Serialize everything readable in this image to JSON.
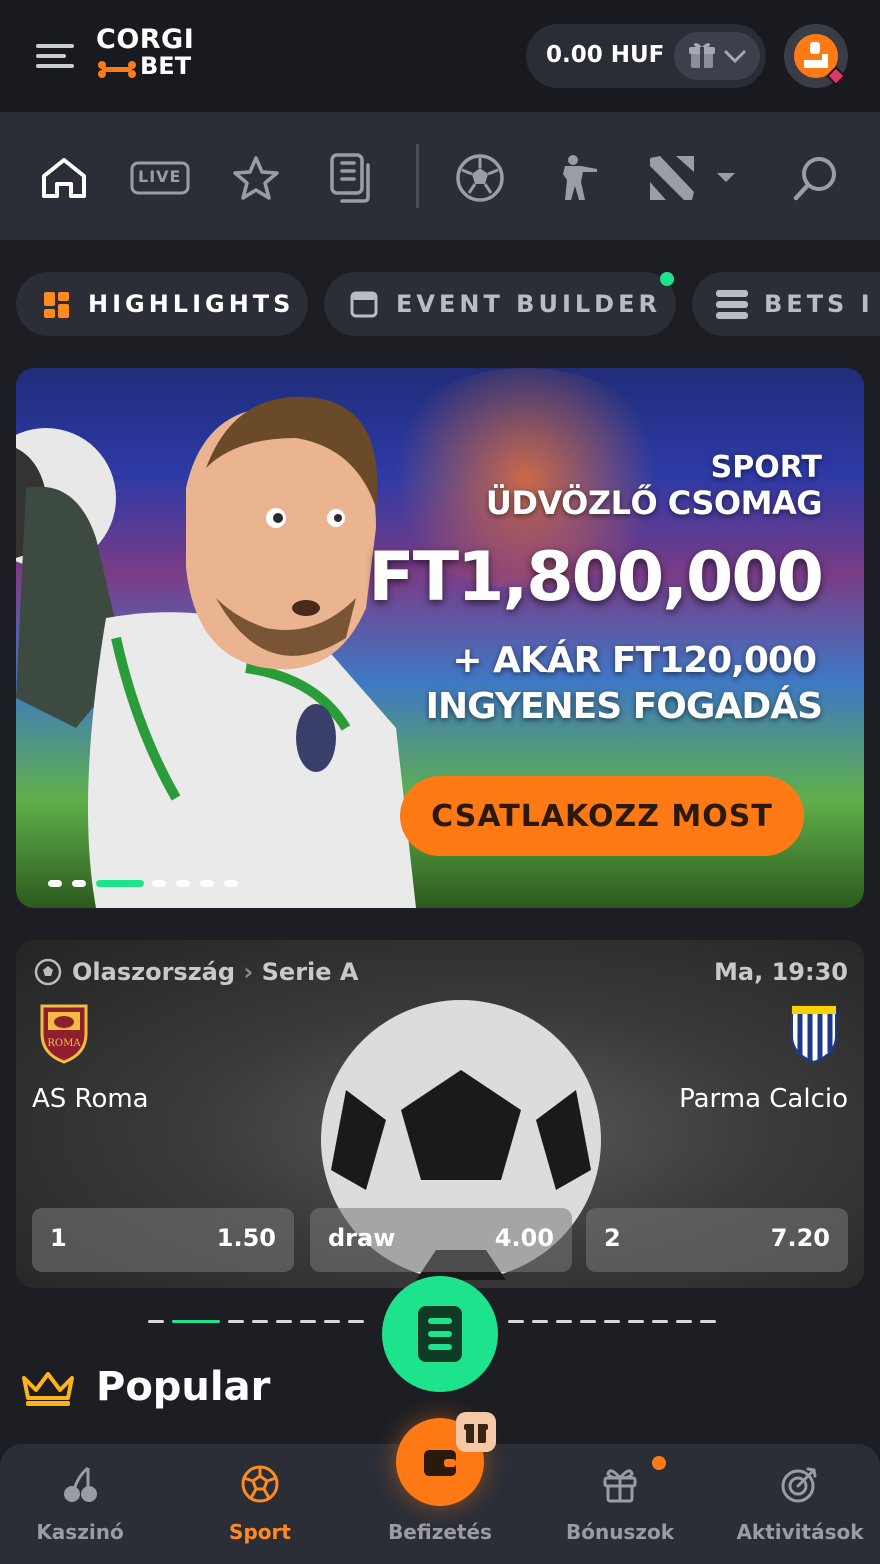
{
  "header": {
    "logo_line1": "CORGI",
    "logo_line2": "BET",
    "balance": "0.00 HUF"
  },
  "sport_nav": {
    "items": [
      "home-icon",
      "live-icon",
      "star-icon",
      "betslip-icon",
      "soccer-ball-icon",
      "counter-strike-icon",
      "dota-icon",
      "dropdown-icon",
      "search-icon"
    ],
    "live_label": "LIVE"
  },
  "tabs": [
    {
      "label": "HIGHLIGHTS",
      "active": true
    },
    {
      "label": "EVENT BUILDER",
      "active": false,
      "has_new_dot": true
    },
    {
      "label": "BETS I",
      "active": false
    }
  ],
  "banner": {
    "line1": "SPORT",
    "line2": "ÜDVÖZLŐ CSOMAG",
    "line3": "FT1,800,000",
    "line4": "+ AKÁR FT120,000",
    "line5": "INGYENES FOGADÁS",
    "cta": "CSATLAKOZZ MOST",
    "slides": 8,
    "active_slide": 3
  },
  "match": {
    "country": "Olaszország",
    "league": "Serie A",
    "time": "Ma, 19:30",
    "home_team": "AS Roma",
    "away_team": "Parma Calcio",
    "home_crest_text": "ROMA",
    "odds": [
      {
        "key": "1",
        "value": "1.50"
      },
      {
        "key": "draw",
        "value": "4.00"
      },
      {
        "key": "2",
        "value": "7.20"
      }
    ]
  },
  "section": {
    "popular_title": "Popular"
  },
  "bottom_nav": [
    {
      "label": "Kaszinó",
      "icon": "cherries-icon",
      "active": false
    },
    {
      "label": "Sport",
      "icon": "soccer-ball-icon",
      "active": true
    },
    {
      "label": "Befizetés",
      "icon": "wallet-icon",
      "active": false
    },
    {
      "label": "Bónuszok",
      "icon": "gift-icon",
      "active": false,
      "has_notification": true
    },
    {
      "label": "Aktivitások",
      "icon": "target-icon",
      "active": false
    }
  ],
  "colors": {
    "accent_orange": "#ff7a14",
    "accent_green": "#1de38c",
    "background": "#1c1e24",
    "panel": "#2b2e37"
  }
}
